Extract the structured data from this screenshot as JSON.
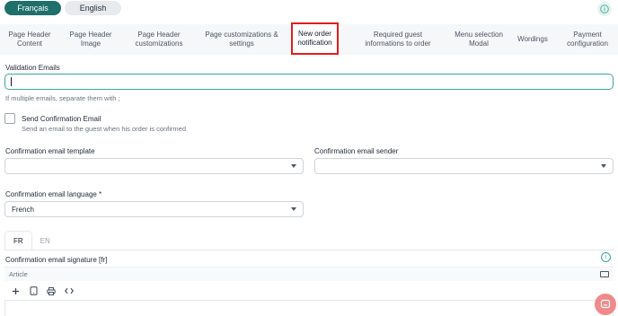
{
  "language_switch": {
    "fr": "Français",
    "en": "English"
  },
  "tabs": [
    {
      "label": "Page Header\nContent"
    },
    {
      "label": "Page Header\nImage"
    },
    {
      "label": "Page Header\ncustomizations"
    },
    {
      "label": "Page customizations &\nsettings"
    },
    {
      "label": "New order\nnotification"
    },
    {
      "label": "Required guest\ninformations to order"
    },
    {
      "label": "Menu selection\nModal"
    },
    {
      "label": "Wordings"
    },
    {
      "label": "Payment\nconfiguration"
    }
  ],
  "validation_emails": {
    "label": "Validation Emails",
    "value": "",
    "hint": "If multiple emails, separate them with ;"
  },
  "send_confirmation": {
    "label": "Send Confirmation Email",
    "description": "Send an email to the guest when his order is confirmed"
  },
  "confirmation_template": {
    "label": "Confirmation email template",
    "value": ""
  },
  "confirmation_sender": {
    "label": "Confirmation email sender",
    "value": ""
  },
  "confirmation_language": {
    "label": "Confirmation email language *",
    "value": "French"
  },
  "signature_tabs": [
    "FR",
    "EN"
  ],
  "signature": {
    "label": "Confirmation email signature [fr]",
    "block_type": "Article"
  },
  "colors": {
    "primary": "#1f6f6b",
    "focus": "#3aa79a",
    "highlight": "#e11d1d",
    "chat": "#f08a8a"
  }
}
